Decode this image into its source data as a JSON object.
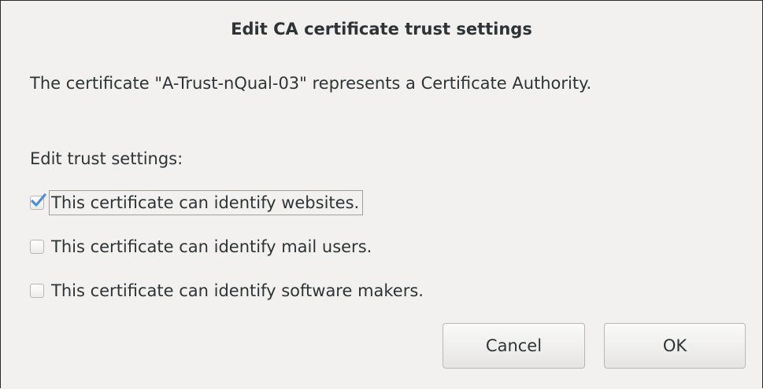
{
  "dialog": {
    "title": "Edit CA certificate trust settings",
    "message": "The certificate \"A-Trust-nQual-03\" represents a Certificate Authority.",
    "trust_label": "Edit trust settings:",
    "options": [
      {
        "label": "This certificate can identify websites.",
        "checked": true
      },
      {
        "label": "This certificate can identify mail users.",
        "checked": false
      },
      {
        "label": "This certificate can identify software makers.",
        "checked": false
      }
    ],
    "buttons": {
      "cancel": "Cancel",
      "ok": "OK"
    }
  },
  "colors": {
    "background": "#f2f1f0",
    "text": "#2e3436",
    "check_accent": "#4a90d9"
  }
}
